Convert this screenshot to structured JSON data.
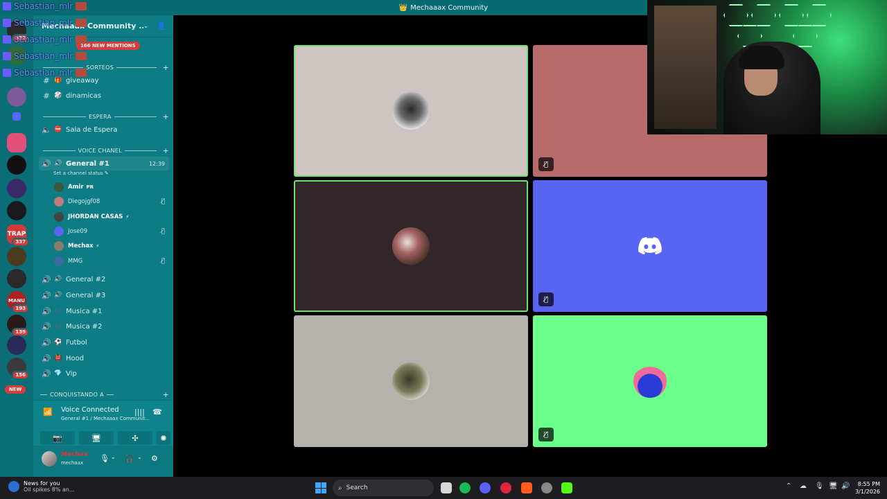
{
  "window": {
    "title": "Mechaaax Community"
  },
  "overlay_chat": {
    "username": "Sebastian_mlr"
  },
  "rail": {
    "badges": [
      "332",
      "337",
      "193",
      "139",
      "156"
    ],
    "trap_label": "TRAP",
    "manu_label": "MANU",
    "new_label": "NEW"
  },
  "server": {
    "name": "Mechaaax Community ...",
    "mentions": "166 NEW MENTIONS"
  },
  "categories": {
    "sorteos": "SORTEOS",
    "espera": "ESPERA",
    "voice": "VOICE CHANEL",
    "conquistando": "CONQUISTANDO A"
  },
  "channels": {
    "giveaway": "giveaway",
    "dinamicas": "dinamicas",
    "sala_espera": "Sala de Espera",
    "general1": "General #1",
    "general1_time": "12:39",
    "status_hint": "Set a channel status",
    "general2": "General #2",
    "general3": "General #3",
    "musica1": "Musica #1",
    "musica2": "Musica #2",
    "futbol": "Futbol",
    "hood": "Hood",
    "vip": "Vip"
  },
  "members": [
    {
      "name": "Amir",
      "suffix": "PR",
      "bold": true,
      "muted": false
    },
    {
      "name": "Diegojgf08",
      "suffix": "",
      "bold": false,
      "muted": true
    },
    {
      "name": "JHORDAN CASAS",
      "suffix": "⚡",
      "bold": true,
      "muted": false
    },
    {
      "name": "Jose09",
      "suffix": "",
      "bold": false,
      "muted": true
    },
    {
      "name": "Mechax",
      "suffix": "⚡",
      "bold": true,
      "muted": false
    },
    {
      "name": "MMG",
      "suffix": "",
      "bold": false,
      "muted": true
    }
  ],
  "voice": {
    "status": "Voice Connected",
    "location": "General #1 / Mechaaax Communit..."
  },
  "user": {
    "display_name": "Mechax",
    "username": "mechaax"
  },
  "taskbar": {
    "news_title": "News for you",
    "news_sub": "Oil spikes 8% an...",
    "search": "Search",
    "time": "8:55 PM",
    "date": "3/1/2026"
  },
  "colors": {
    "sidebar": "#0d7c84",
    "tile_top_left": "#cdc5c2",
    "tile_top_right": "#b86b6b",
    "tile_mid_left": "#32262a",
    "tile_mid_right": "#5865f2",
    "tile_bottom_left": "#b5b1ac",
    "tile_bottom_right": "#6bff8c",
    "speaking": "#6fe36f"
  }
}
